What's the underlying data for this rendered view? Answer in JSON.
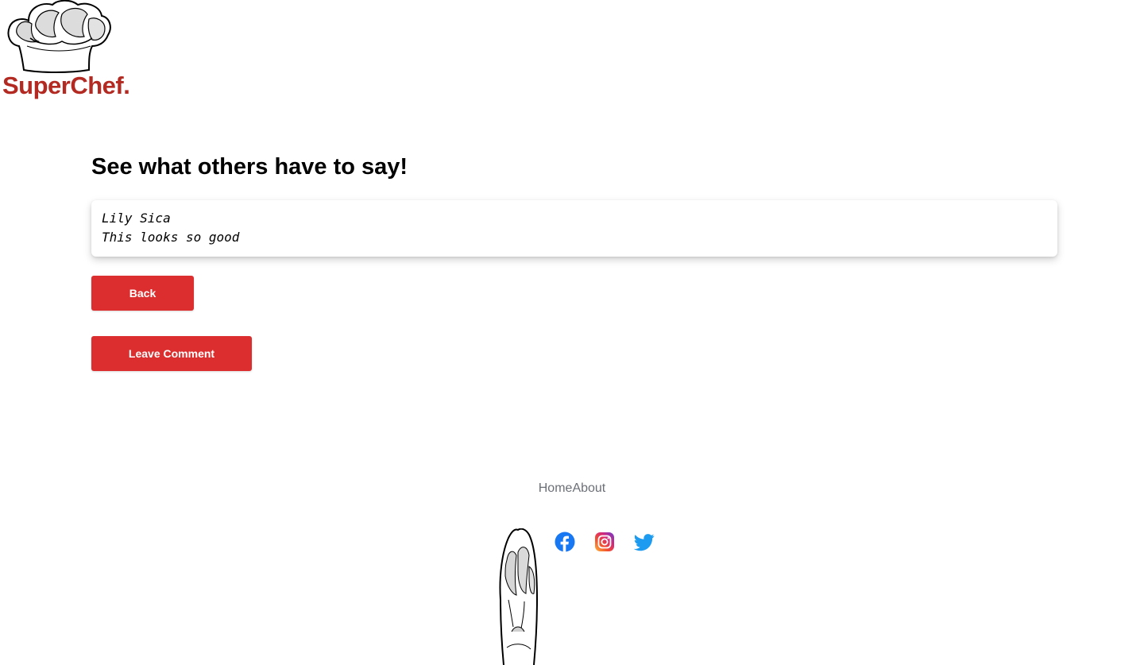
{
  "brand": {
    "name": "SuperChef."
  },
  "main": {
    "heading": "See what others have to say!",
    "comments": [
      {
        "author": "Lily Sica",
        "text": "This looks so good"
      }
    ],
    "back_label": "Back",
    "leave_comment_label": "Leave Comment"
  },
  "footer": {
    "nav": [
      {
        "label": "Home"
      },
      {
        "label": "About"
      }
    ],
    "social": [
      {
        "icon": "facebook-icon"
      },
      {
        "icon": "instagram-icon"
      },
      {
        "icon": "twitter-icon"
      }
    ]
  },
  "colors": {
    "brand": "#b22a22",
    "button": "#dc2e2e",
    "footer_text": "#6b6f76",
    "facebook": "#1877f2",
    "twitter": "#1d9bf0"
  }
}
